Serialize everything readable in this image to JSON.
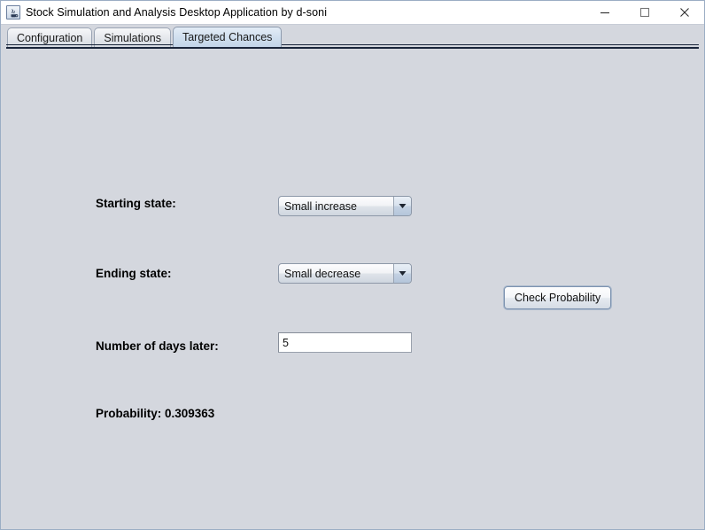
{
  "window": {
    "title": "Stock Simulation and Analysis Desktop Application by d-soni",
    "icon": "java-coffee-cup-icon",
    "controls": {
      "minimize": "Minimize",
      "maximize": "Maximize",
      "close": "Close"
    },
    "background_color": "#d4d7de",
    "border_color": "#9badc4"
  },
  "tabs": [
    {
      "label": "Configuration",
      "selected": false
    },
    {
      "label": "Simulations",
      "selected": false
    },
    {
      "label": "Targeted Chances",
      "selected": true
    }
  ],
  "form": {
    "starting_state": {
      "label": "Starting state:",
      "value": "Small increase"
    },
    "ending_state": {
      "label": "Ending state:",
      "value": "Small decrease"
    },
    "days_later": {
      "label": "Number of days later:",
      "value": "5"
    },
    "check_button": "Check Probability",
    "result": "Probability: 0.309363"
  }
}
